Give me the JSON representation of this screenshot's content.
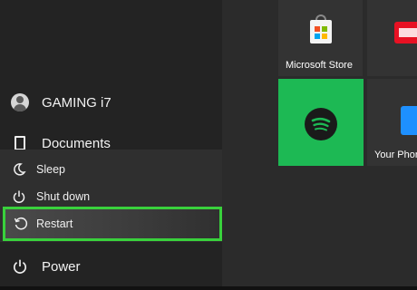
{
  "user": {
    "name": "GAMING i7"
  },
  "nav": {
    "documents_label": "Documents",
    "power_label": "Power"
  },
  "power_menu": {
    "sleep_label": "Sleep",
    "shutdown_label": "Shut down",
    "restart_label": "Restart"
  },
  "tiles": {
    "store_label": "Microsoft Store",
    "phone_label": "Your Phone"
  },
  "colors": {
    "highlight": "#39d13c",
    "spotify": "#1db954"
  }
}
